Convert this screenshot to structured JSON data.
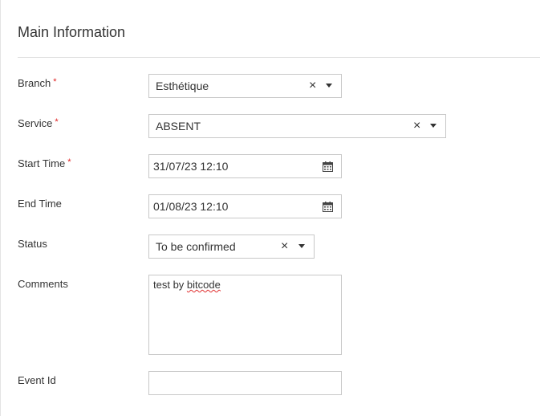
{
  "section": {
    "title": "Main Information"
  },
  "fields": {
    "branch": {
      "label": "Branch",
      "required": "*",
      "value": "Esthétique"
    },
    "service": {
      "label": "Service",
      "required": "*",
      "value": "ABSENT"
    },
    "start_time": {
      "label": "Start Time",
      "required": "*",
      "value": "31/07/23 12:10"
    },
    "end_time": {
      "label": "End Time",
      "value": "01/08/23 12:10"
    },
    "status": {
      "label": "Status",
      "value": "To be confirmed"
    },
    "comments": {
      "label": "Comments",
      "value_prefix": "test by ",
      "value_misspelled": "bitcode"
    },
    "event_id": {
      "label": "Event Id",
      "value": ""
    }
  },
  "icons": {
    "clear": "×",
    "dropdown": "chevron-down-icon",
    "calendar": "calendar-icon"
  },
  "colors": {
    "required": "#e02020",
    "border": "#c8c8c8",
    "spellcheck": "#e03030"
  }
}
